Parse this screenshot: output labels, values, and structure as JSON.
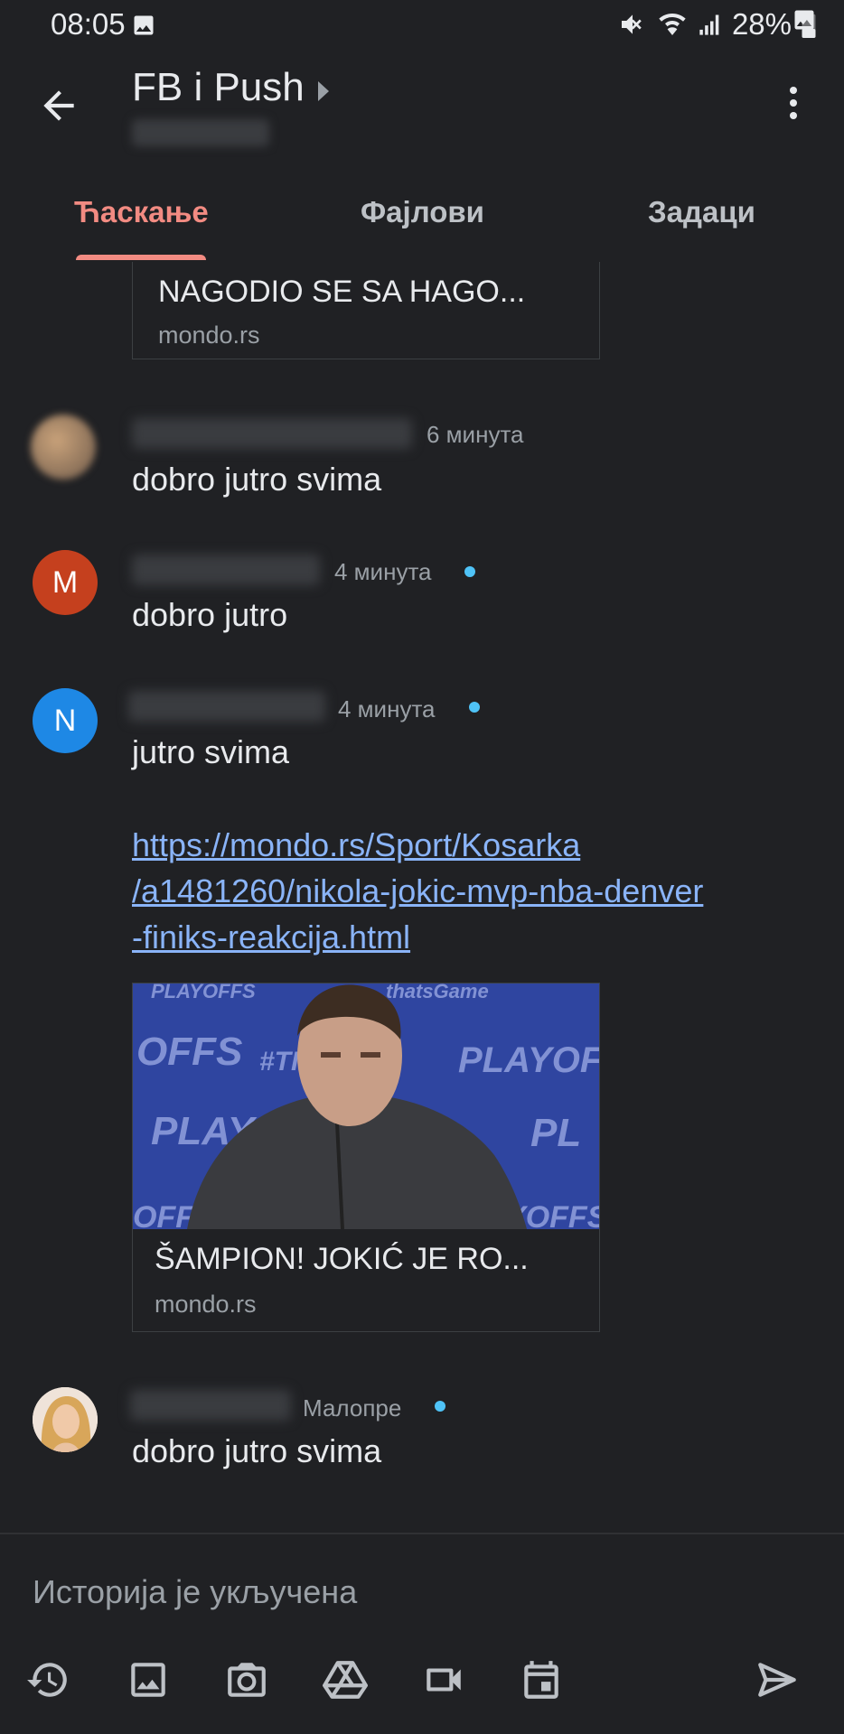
{
  "status_bar": {
    "time": "08:05",
    "battery": "28%"
  },
  "header": {
    "title": "FB i Push"
  },
  "tabs": [
    "Ћаскање",
    "Фајлови",
    "Задаци"
  ],
  "top_card": {
    "title": "NAGODIO SE SA HAGO...",
    "source": "mondo.rs"
  },
  "messages": [
    {
      "time": "6 минута",
      "text": "dobro jutro svima"
    },
    {
      "avatar_letter": "M",
      "avatar_color": "#c5401e",
      "time": "4 минута",
      "text": "dobro jutro"
    },
    {
      "avatar_letter": "N",
      "avatar_color": "#1e88e5",
      "time": "4 минута",
      "text": "jutro svima",
      "link_lines": [
        "https://mondo.rs/Sport/Kosarka",
        "/a1481260/nikola-jokic-mvp-nba-denver",
        "-finiks-reakcija.html"
      ],
      "card": {
        "title": "ŠAMPION! JOKIĆ JE RO...",
        "source": "mondo.rs"
      }
    },
    {
      "time": "Малопре",
      "text": "dobro jutro svima"
    }
  ],
  "composer": {
    "placeholder": "Историја је укључена"
  },
  "toolbar_icons": [
    "history-icon",
    "image-icon",
    "camera-icon",
    "drive-icon",
    "video-icon",
    "calendar-icon",
    "send-icon"
  ]
}
